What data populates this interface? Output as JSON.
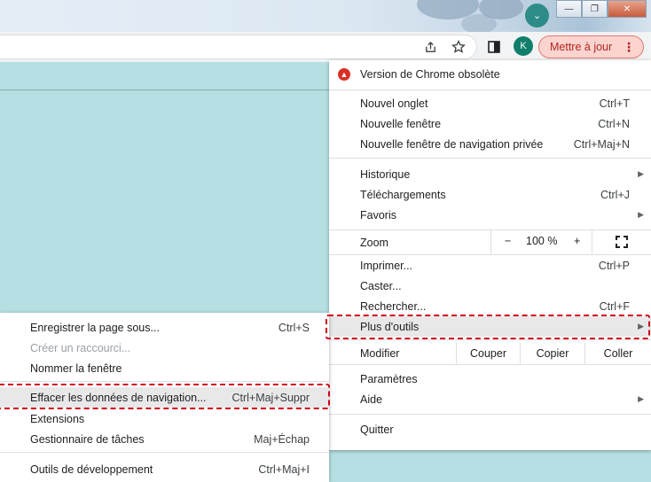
{
  "window": {
    "minimize_glyph": "—",
    "restore_glyph": "❐",
    "close_glyph": "✕",
    "tab_search_glyph": "⌄"
  },
  "toolbar": {
    "avatar_initial": "K",
    "update_button": "Mettre à jour",
    "menu_dots": "⋮"
  },
  "menu": {
    "update_notice": "Version de Chrome obsolète",
    "new_tab": {
      "label": "Nouvel onglet",
      "shortcut": "Ctrl+T"
    },
    "new_window": {
      "label": "Nouvelle fenêtre",
      "shortcut": "Ctrl+N"
    },
    "new_incognito": {
      "label": "Nouvelle fenêtre de navigation privée",
      "shortcut": "Ctrl+Maj+N"
    },
    "history": {
      "label": "Historique"
    },
    "downloads": {
      "label": "Téléchargements",
      "shortcut": "Ctrl+J"
    },
    "bookmarks": {
      "label": "Favoris"
    },
    "zoom": {
      "label": "Zoom",
      "minus": "−",
      "value": "100 %",
      "plus": "+"
    },
    "print": {
      "label": "Imprimer...",
      "shortcut": "Ctrl+P"
    },
    "cast": {
      "label": "Caster..."
    },
    "find": {
      "label": "Rechercher...",
      "shortcut": "Ctrl+F"
    },
    "more_tools": {
      "label": "Plus d'outils"
    },
    "edit": {
      "label": "Modifier",
      "cut": "Couper",
      "copy": "Copier",
      "paste": "Coller"
    },
    "settings": {
      "label": "Paramètres"
    },
    "help": {
      "label": "Aide"
    },
    "quit": {
      "label": "Quitter"
    }
  },
  "submenu": {
    "save_page": {
      "label": "Enregistrer la page sous...",
      "shortcut": "Ctrl+S"
    },
    "create_shortcut": {
      "label": "Créer un raccourci..."
    },
    "name_window": {
      "label": "Nommer la fenêtre"
    },
    "clear_data": {
      "label": "Effacer les données de navigation...",
      "shortcut": "Ctrl+Maj+Suppr"
    },
    "extensions": {
      "label": "Extensions"
    },
    "task_manager": {
      "label": "Gestionnaire de tâches",
      "shortcut": "Maj+Échap"
    },
    "dev_tools": {
      "label": "Outils de développement",
      "shortcut": "Ctrl+Maj+I"
    }
  },
  "colors": {
    "accent_update": "#d93025",
    "annotation": "#d0021b",
    "page_bg": "#b5dfe2"
  }
}
